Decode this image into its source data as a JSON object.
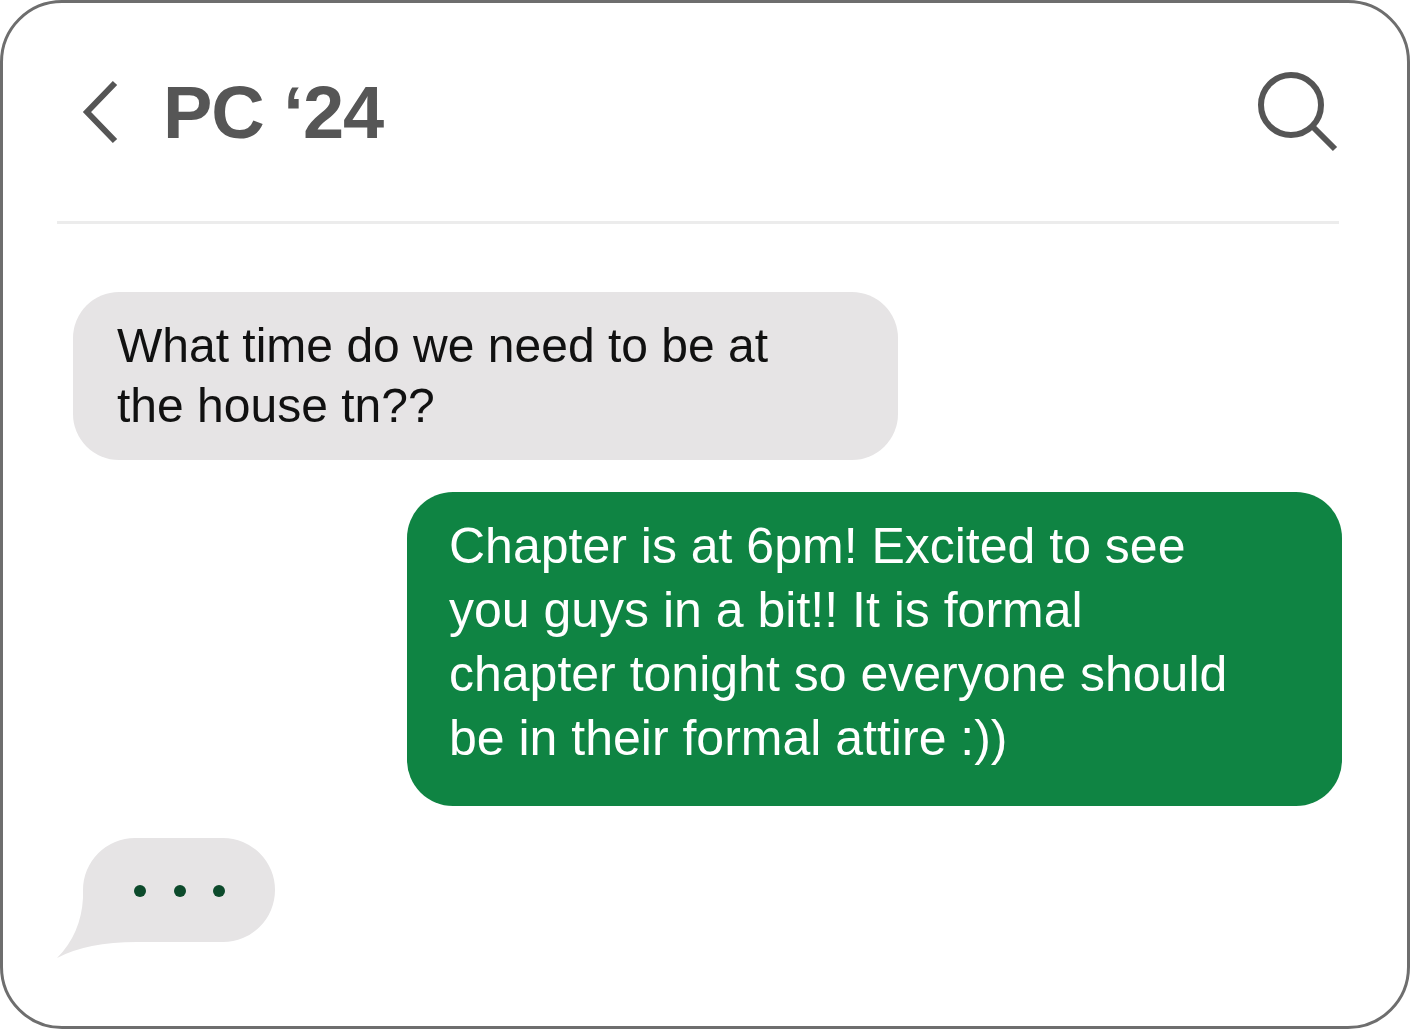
{
  "header": {
    "title": "PC ‘24"
  },
  "messages": [
    {
      "kind": "received",
      "text": "What time do we need to be at the house tn??"
    },
    {
      "kind": "sent",
      "text": "Chapter is at 6pm! Excited to see you guys in a bit!! It is formal chapter tonight so everyone should be in their formal attire :))"
    }
  ],
  "typing_indicator": {
    "visible": true
  }
}
